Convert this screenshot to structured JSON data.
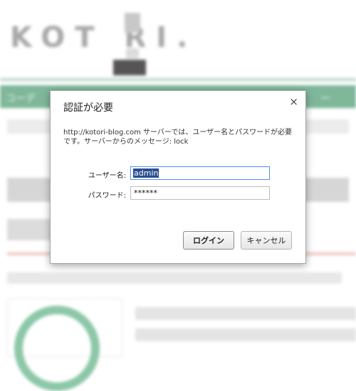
{
  "background": {
    "logo_text": "KOT  RI.",
    "nav_left": "コーデ",
    "nav_right": "ー"
  },
  "dialog": {
    "title": "認証が必要",
    "close_glyph": "×",
    "message": "http://kotori-blog.com サーバーでは、ユーザー名とパスワードが必要です。サーバーからのメッセージ: lock",
    "username_label": "ユーザー名:",
    "username_value": "admin",
    "password_label": "パスワード:",
    "password_value": "******",
    "login_button": "ログイン",
    "cancel_button": "キャンセル"
  }
}
